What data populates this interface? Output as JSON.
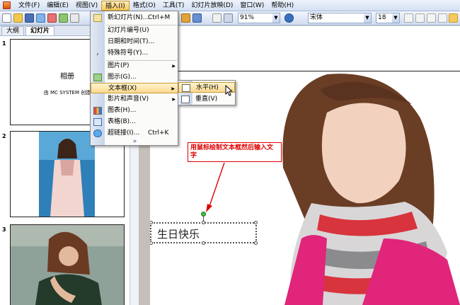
{
  "menubar": {
    "items": [
      "文件(F)",
      "编辑(E)",
      "视图(V)",
      "插入(I)",
      "格式(O)",
      "工具(T)",
      "幻灯片放映(D)",
      "窗口(W)",
      "帮助(H)"
    ]
  },
  "toolbar": {
    "zoom": "91%",
    "font_name": "宋体",
    "font_size": "18"
  },
  "left_pane": {
    "tabs": [
      "大纲",
      "幻灯片"
    ],
    "close": "×",
    "slides": [
      {
        "number": "1",
        "title": "相册",
        "subtitle": "由 MC SYSTEM 创建"
      },
      {
        "number": "2"
      },
      {
        "number": "3"
      }
    ]
  },
  "insert_menu": {
    "items": [
      {
        "label": "新幻灯片(N)...",
        "shortcut": "Ctrl+M"
      },
      {
        "label": "幻灯片编号(U)"
      },
      {
        "label": "日期和时间(T)..."
      },
      {
        "label": "特殊符号(Y)..."
      },
      {
        "label": "图片(P)"
      },
      {
        "label": "图示(G)..."
      },
      {
        "label": "文本框(X)"
      },
      {
        "label": "影片和声音(V)"
      },
      {
        "label": "图表(H)..."
      },
      {
        "label": "表格(B)..."
      },
      {
        "label": "超链接(I)...",
        "shortcut": "Ctrl+K"
      }
    ],
    "expand": "»"
  },
  "textbox_submenu": {
    "items": [
      {
        "label": "水平(H)"
      },
      {
        "label": "垂直(V)"
      }
    ]
  },
  "annotation": {
    "text": "用鼠标绘制文本框然后输入文字"
  },
  "slide": {
    "textbox_text": "生日快乐"
  },
  "colors": {
    "accent": "#e00000",
    "menu_highlight": "#fcd98f",
    "toolbar": "#cfdcf0"
  }
}
